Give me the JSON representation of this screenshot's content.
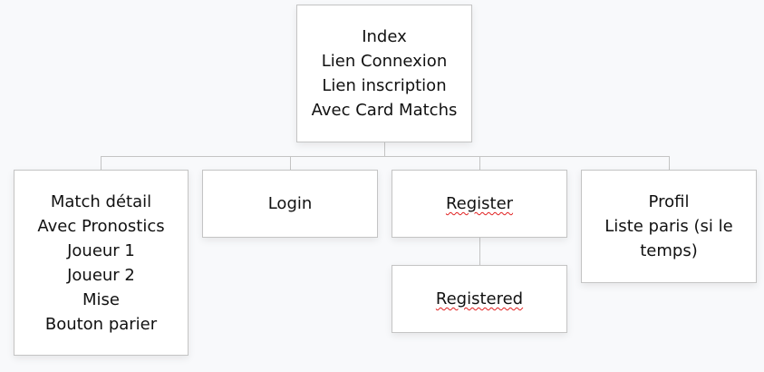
{
  "nodes": {
    "index": {
      "lines": [
        "Index",
        "Lien Connexion",
        "Lien inscription",
        "Avec Card Matchs"
      ]
    },
    "match_detail": {
      "lines": [
        "Match détail",
        "Avec Pronostics",
        "Joueur 1",
        "Joueur 2",
        "Mise",
        "Bouton parier"
      ]
    },
    "login": {
      "lines": [
        "Login"
      ]
    },
    "register": {
      "lines": [
        "Register"
      ]
    },
    "registered": {
      "lines": [
        "Registered"
      ]
    },
    "profil": {
      "lines": [
        "Profil",
        "Liste paris (si le",
        "temps)"
      ]
    }
  }
}
